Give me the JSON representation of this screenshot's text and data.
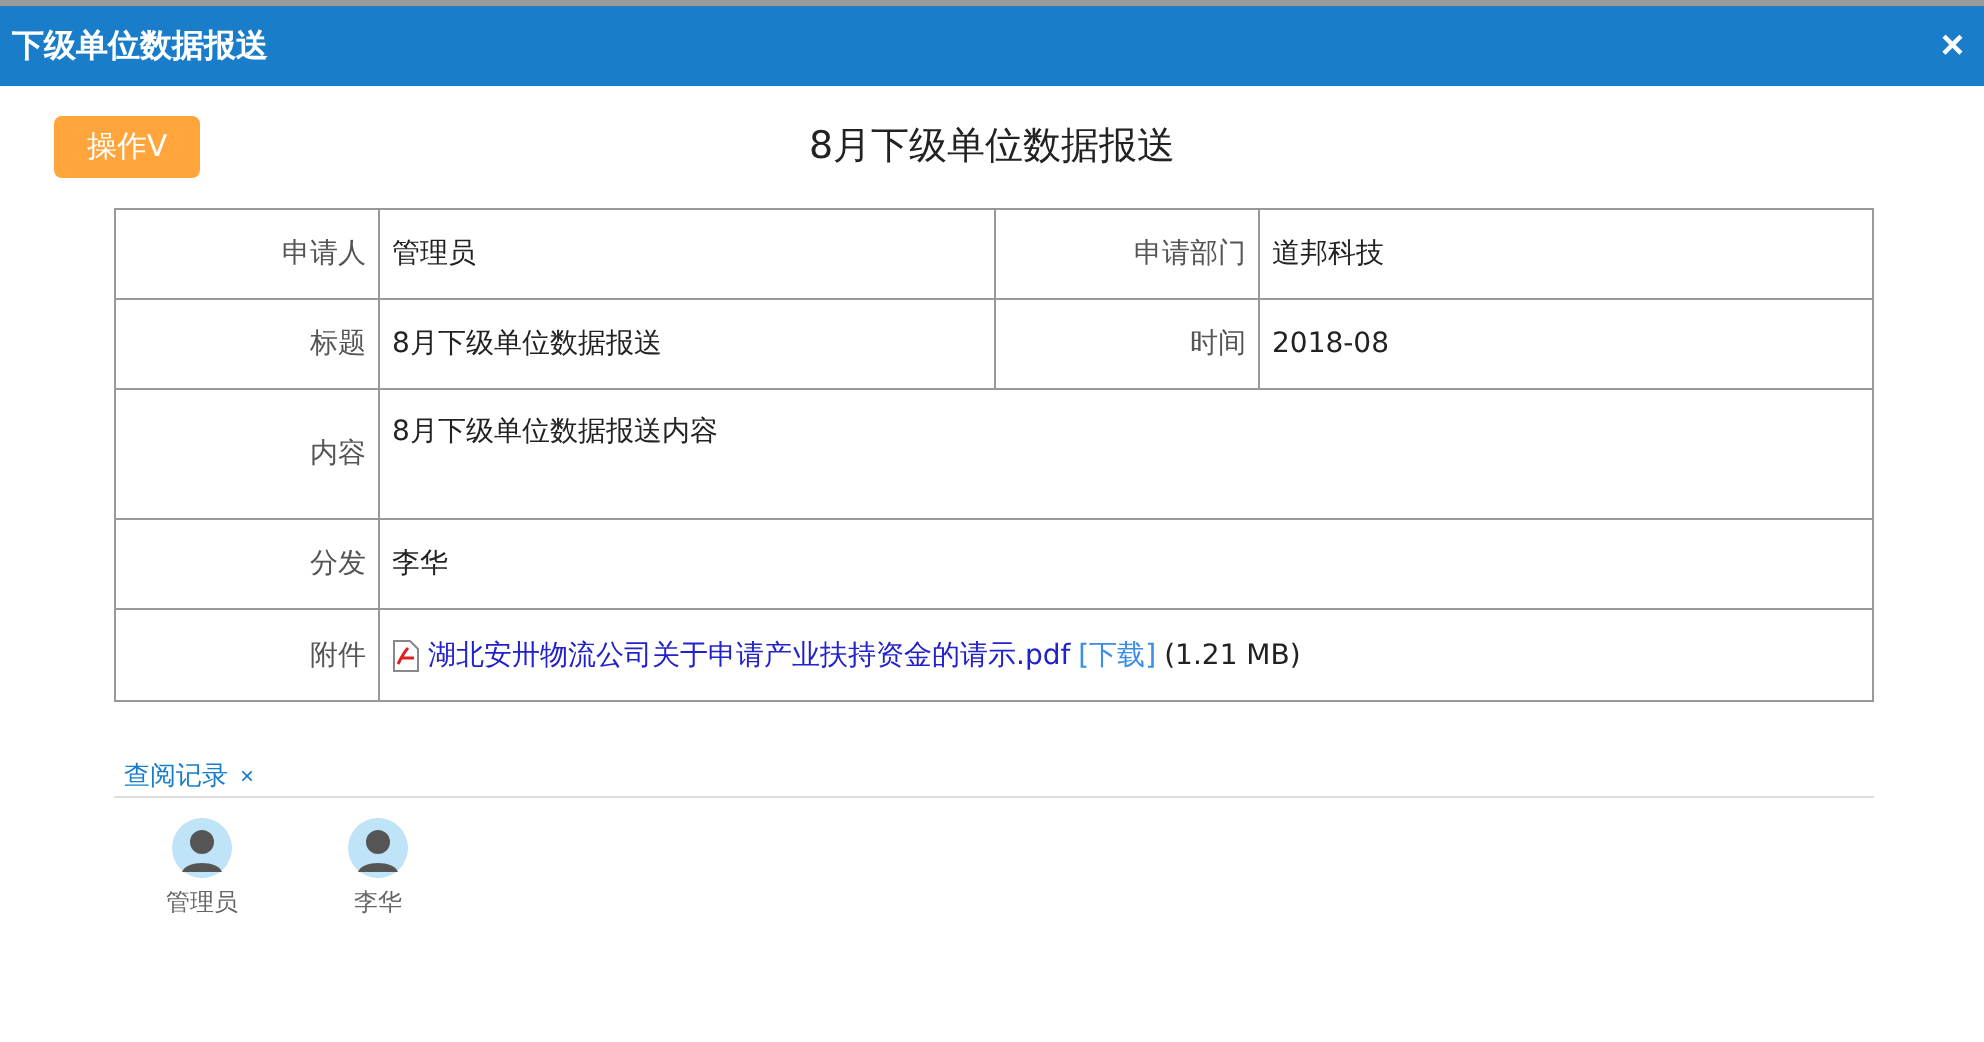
{
  "window": {
    "title": "下级单位数据报送",
    "close": "×"
  },
  "action_button": "操作V",
  "heading": "8月下级单位数据报送",
  "rows": [
    {
      "kind": "pair",
      "cells": [
        {
          "label": "申请人",
          "value": "管理员"
        },
        {
          "label": "申请部门",
          "value": "道邦科技"
        }
      ]
    },
    {
      "kind": "pair",
      "cells": [
        {
          "label": "标题",
          "value": "8月下级单位数据报送"
        },
        {
          "label": "时间",
          "value": "2018-08"
        }
      ]
    },
    {
      "kind": "tall",
      "label": "内容",
      "value": "8月下级单位数据报送内容"
    },
    {
      "kind": "text",
      "label": "分发",
      "value": "李华"
    },
    {
      "kind": "file",
      "label": "附件",
      "file_name": "湖北安卅物流公司关于申请产业扶持资金的请示.pdf",
      "download": "[下载]",
      "size": "(1.21 MB)"
    }
  ],
  "read_log": {
    "tab": "查阅记录",
    "close": "×",
    "readers": [
      {
        "name": "管理员"
      },
      {
        "name": "李华"
      }
    ]
  }
}
